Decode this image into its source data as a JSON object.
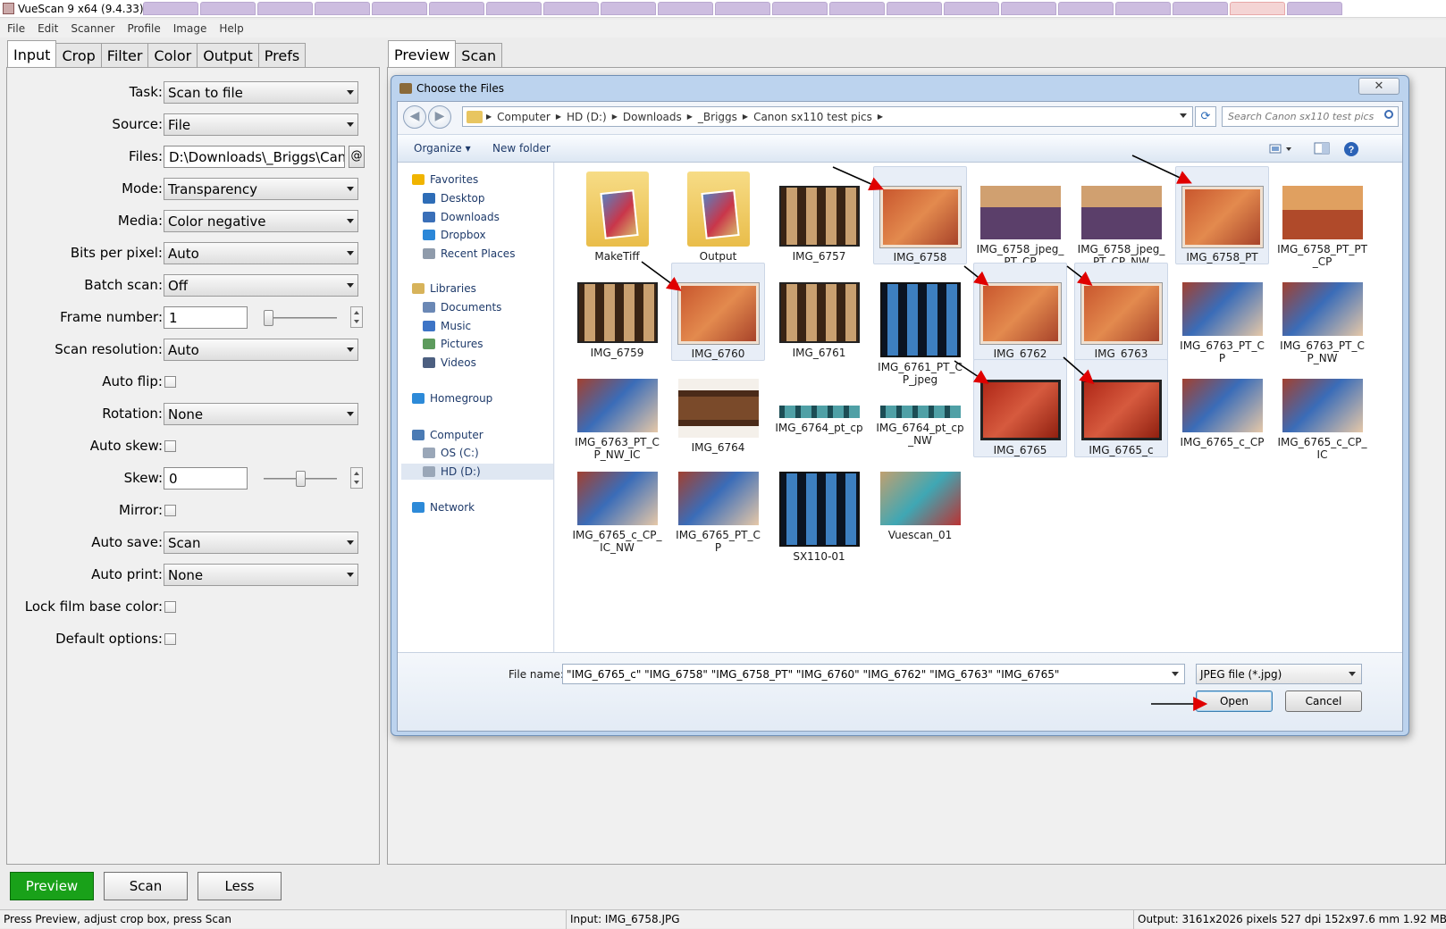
{
  "window": {
    "title": "VueScan 9 x64 (9.4.33)"
  },
  "menu": [
    "File",
    "Edit",
    "Scanner",
    "Profile",
    "Image",
    "Help"
  ],
  "left_tabs": [
    {
      "label": "Input",
      "active": true
    },
    {
      "label": "Crop",
      "active": false
    },
    {
      "label": "Filter",
      "active": false
    },
    {
      "label": "Color",
      "active": false
    },
    {
      "label": "Output",
      "active": false
    },
    {
      "label": "Prefs",
      "active": false
    }
  ],
  "right_tabs": [
    {
      "label": "Preview",
      "active": true
    },
    {
      "label": "Scan",
      "active": false
    }
  ],
  "input": {
    "task": {
      "label": "Task:",
      "value": "Scan to file"
    },
    "source": {
      "label": "Source:",
      "value": "File"
    },
    "files": {
      "label": "Files:",
      "value": "D:\\Downloads\\_Briggs\\Canon",
      "button": "@"
    },
    "mode": {
      "label": "Mode:",
      "value": "Transparency"
    },
    "media": {
      "label": "Media:",
      "value": "Color negative"
    },
    "bits": {
      "label": "Bits per pixel:",
      "value": "Auto"
    },
    "batch": {
      "label": "Batch scan:",
      "value": "Off"
    },
    "frame": {
      "label": "Frame number:",
      "value": "1"
    },
    "resolution": {
      "label": "Scan resolution:",
      "value": "Auto"
    },
    "autoflip": {
      "label": "Auto flip:",
      "checked": false
    },
    "rotation": {
      "label": "Rotation:",
      "value": "None"
    },
    "autoskew": {
      "label": "Auto skew:",
      "checked": false
    },
    "skew": {
      "label": "Skew:",
      "value": "0"
    },
    "mirror": {
      "label": "Mirror:",
      "checked": false
    },
    "autosave": {
      "label": "Auto save:",
      "value": "Scan"
    },
    "autoprint": {
      "label": "Auto print:",
      "value": "None"
    },
    "lockfilm": {
      "label": "Lock film base color:",
      "checked": false
    },
    "defaults": {
      "label": "Default options:",
      "checked": false
    }
  },
  "bottom_buttons": {
    "preview": "Preview",
    "scan": "Scan",
    "less": "Less"
  },
  "status": {
    "left": "Press Preview, adjust crop box, press Scan",
    "middle": "Input: IMG_6758.JPG",
    "right": "Output: 3161x2026 pixels 527 dpi 152x97.6 mm 1.92 MB"
  },
  "dialog": {
    "title": "Choose the Files",
    "close": "✕",
    "breadcrumb": [
      "Computer",
      "HD (D:)",
      "Downloads",
      "_Briggs",
      "Canon sx110 test pics"
    ],
    "search_placeholder": "Search Canon sx110 test pics",
    "toolbar": {
      "organize": "Organize",
      "new_folder": "New folder"
    },
    "nav": {
      "favorites": "Favorites",
      "fav_items": [
        "Desktop",
        "Downloads",
        "Dropbox",
        "Recent Places"
      ],
      "libraries": "Libraries",
      "lib_items": [
        "Documents",
        "Music",
        "Pictures",
        "Videos"
      ],
      "homegroup": "Homegroup",
      "computer": "Computer",
      "drives": [
        "OS (C:)",
        "HD (D:)"
      ],
      "network": "Network"
    },
    "files": [
      {
        "name": "MakeTiff",
        "kind": "folder",
        "selected": false
      },
      {
        "name": "Output",
        "kind": "folder",
        "selected": false
      },
      {
        "name": "IMG_6757",
        "kind": "strip",
        "selected": false
      },
      {
        "name": "IMG_6758",
        "kind": "neg",
        "selected": true
      },
      {
        "name": "IMG_6758_jpeg_PT_CP",
        "kind": "photo-purple",
        "selected": false
      },
      {
        "name": "IMG_6758_jpeg_PT_CP_NW",
        "kind": "photo-purple",
        "selected": false
      },
      {
        "name": "IMG_6758_PT",
        "kind": "neg",
        "selected": true
      },
      {
        "name": "IMG_6758_PT_PT_CP",
        "kind": "photo-orange",
        "selected": false
      },
      {
        "name": "IMG_6759",
        "kind": "strip",
        "selected": false
      },
      {
        "name": "IMG_6760",
        "kind": "neg",
        "selected": true
      },
      {
        "name": "IMG_6761",
        "kind": "strip",
        "selected": false
      },
      {
        "name": "IMG_6761_PT_CP_jpeg",
        "kind": "strip-blue",
        "selected": false
      },
      {
        "name": "IMG_6762",
        "kind": "neg",
        "selected": true
      },
      {
        "name": "IMG_6763",
        "kind": "neg",
        "selected": true
      },
      {
        "name": "IMG_6763_PT_CP",
        "kind": "photo-blue",
        "selected": false
      },
      {
        "name": "IMG_6763_PT_CP_NW",
        "kind": "photo-blue",
        "selected": false
      },
      {
        "name": "IMG_6763_PT_CP_NW_IC",
        "kind": "photo-blue",
        "selected": false
      },
      {
        "name": "IMG_6764",
        "kind": "filmstrip-brown",
        "selected": false
      },
      {
        "name": "IMG_6764_pt_cp",
        "kind": "thin-teal",
        "selected": false
      },
      {
        "name": "IMG_6764_pt_cp_NW",
        "kind": "thin-teal",
        "selected": false
      },
      {
        "name": "IMG_6765",
        "kind": "neg-red",
        "selected": true
      },
      {
        "name": "IMG_6765_c",
        "kind": "neg-red",
        "selected": true
      },
      {
        "name": "IMG_6765_c_CP",
        "kind": "photo-blue",
        "selected": false
      },
      {
        "name": "IMG_6765_c_CP_IC",
        "kind": "photo-blue",
        "selected": false
      },
      {
        "name": "IMG_6765_c_CP_IC_NW",
        "kind": "photo-blue",
        "selected": false
      },
      {
        "name": "IMG_6765_PT_CP",
        "kind": "photo-blue",
        "selected": false
      },
      {
        "name": "SX110-01",
        "kind": "strip-blue",
        "selected": false
      },
      {
        "name": "Vuescan_01",
        "kind": "photo-teal",
        "selected": false
      }
    ],
    "file_name_label": "File name:",
    "file_name_value": "\"IMG_6765_c\" \"IMG_6758\" \"IMG_6758_PT\" \"IMG_6760\" \"IMG_6762\" \"IMG_6763\" \"IMG_6765\"",
    "file_type": "JPEG file (*.jpg)",
    "open": "Open",
    "cancel": "Cancel"
  },
  "colors": {
    "preview_green": "#19a119",
    "annotation_red": "#e00000"
  }
}
